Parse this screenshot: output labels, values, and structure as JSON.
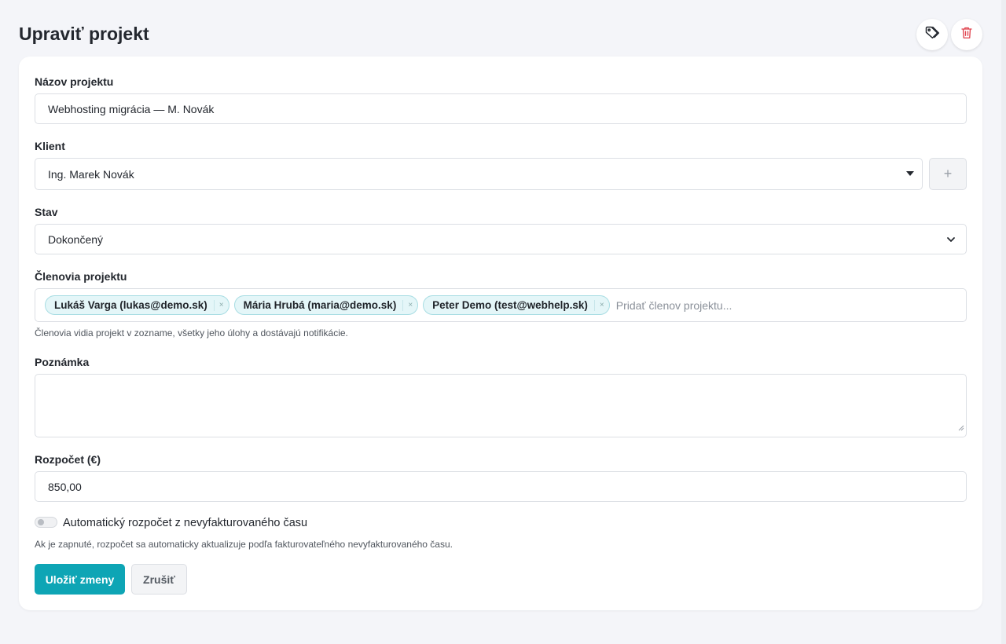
{
  "header": {
    "title": "Upraviť projekt",
    "icons": {
      "tag": "tag-icon",
      "delete": "trash-icon"
    },
    "delete_color": "#e0434e"
  },
  "form": {
    "name": {
      "label": "Názov projektu",
      "value": "Webhosting migrácia — M. Novák"
    },
    "client": {
      "label": "Klient",
      "value": "Ing. Marek Novák",
      "add_button": "+"
    },
    "status": {
      "label": "Stav",
      "value": "Dokončený"
    },
    "members": {
      "label": "Členovia projektu",
      "chips": [
        {
          "label": "Lukáš Varga (lukas@demo.sk)",
          "remove": "×"
        },
        {
          "label": "Mária Hrubá (maria@demo.sk)",
          "remove": "×"
        },
        {
          "label": "Peter Demo (test@webhelp.sk)",
          "remove": "×"
        }
      ],
      "placeholder": "Pridať členov projektu...",
      "help": "Členovia vidia projekt v zozname, všetky jeho úlohy a dostávajú notifikácie."
    },
    "note": {
      "label": "Poznámka",
      "value": ""
    },
    "budget": {
      "label": "Rozpočet (€)",
      "value": "850,00"
    },
    "auto_budget": {
      "label": "Automatický rozpočet z nevyfakturovaného času",
      "enabled": false,
      "help": "Ak je zapnuté, rozpočet sa automaticky aktualizuje podľa fakturovateľného nevyfakturovaného času."
    }
  },
  "actions": {
    "save": "Uložiť zmeny",
    "cancel": "Zrušiť"
  },
  "colors": {
    "accent": "#0ea5b5",
    "chip_bg": "#e4f6f8",
    "chip_border": "#a8dde3"
  }
}
